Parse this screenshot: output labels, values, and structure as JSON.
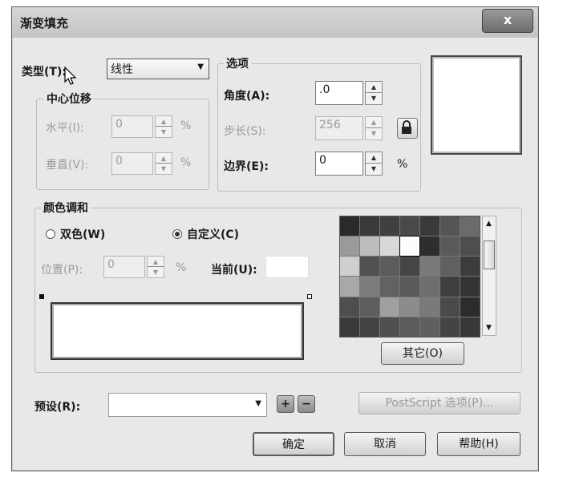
{
  "window": {
    "title": "渐变填充",
    "close_label": "x"
  },
  "type": {
    "label": "类型(T):",
    "value": "线性"
  },
  "center_offset": {
    "legend": "中心位移",
    "horizontal_label": "水平(I):",
    "horizontal_value": "0",
    "vertical_label": "垂直(V):",
    "vertical_value": "0",
    "percent": "%"
  },
  "options": {
    "legend": "选项",
    "angle_label": "角度(A):",
    "angle_value": ".0",
    "steps_label": "步长(S):",
    "steps_value": "256",
    "edge_label": "边界(E):",
    "edge_value": "0",
    "percent": "%"
  },
  "color_blend": {
    "legend": "颜色调和",
    "two_color_label": "双色(W)",
    "custom_label": "自定义(C)",
    "custom_selected": true,
    "position_label": "位置(P):",
    "position_value": "0",
    "percent": "%",
    "current_label": "当前(U):",
    "other_label": "其它(O)"
  },
  "palette": [
    "#2a2a2a",
    "#3a3a3a",
    "#404040",
    "#4a4a4a",
    "#3a3a3a",
    "#555555",
    "#6b6b6b",
    "#9a9a9a",
    "#bdbdbd",
    "#d8d8d8",
    "#fcfcfc",
    "#2e2e2e",
    "#5a5a5a",
    "#4e4e4e",
    "#cfcfcf",
    "#505050",
    "#5c5c5c",
    "#454545",
    "#7a7a7a",
    "#606060",
    "#3c3c3c",
    "#a8a8a8",
    "#7c7c7c",
    "#626262",
    "#5a5a5a",
    "#6e6e6e",
    "#3f3f3f",
    "#343434",
    "#4e4e4e",
    "#5e5e5e",
    "#a0a0a0",
    "#8c8c8c",
    "#7a7a7a",
    "#4a4a4a",
    "#2c2c2c",
    "#3a3a3a",
    "#434343",
    "#4f4f4f",
    "#5b5b5b",
    "#5f5f5f",
    "#444444",
    "#383838"
  ],
  "presets": {
    "label": "预设(R):",
    "value": "",
    "postscript_label": "PostScript 选项(P)..."
  },
  "buttons": {
    "ok": "确定",
    "cancel": "取消",
    "help": "帮助(H)"
  },
  "symbols": {
    "plus": "+",
    "minus": "−",
    "up": "▲",
    "down": "▼",
    "dropdown": "▼"
  }
}
